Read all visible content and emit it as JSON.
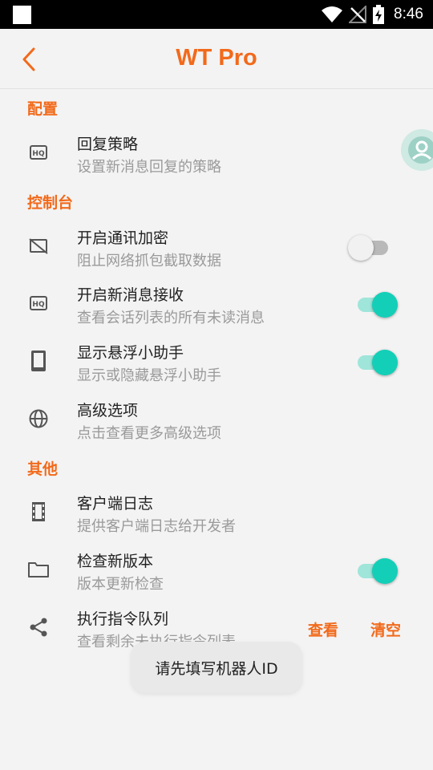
{
  "status_bar": {
    "time": "8:46"
  },
  "app_bar": {
    "title": "WT Pro",
    "back_icon": "chevron-left-icon"
  },
  "sections": {
    "config": "配置",
    "console": "控制台",
    "other": "其他"
  },
  "rows": {
    "reply_policy": {
      "title": "回复策略",
      "subtitle": "设置新消息回复的策略",
      "icon": "hq-icon"
    },
    "encrypt": {
      "title": "开启通讯加密",
      "subtitle": "阻止网络抓包截取数据",
      "icon": "no-screen-icon",
      "enabled": false
    },
    "receive": {
      "title": "开启新消息接收",
      "subtitle": "查看会话列表的所有未读消息",
      "icon": "hq-icon",
      "enabled": true
    },
    "floating": {
      "title": "显示悬浮小助手",
      "subtitle": "显示或隐藏悬浮小助手",
      "icon": "tablet-icon",
      "enabled": true
    },
    "advanced": {
      "title": "高级选项",
      "subtitle": "点击查看更多高级选项",
      "icon": "globe-icon"
    },
    "client_log": {
      "title": "客户端日志",
      "subtitle": "提供客户端日志给开发者",
      "icon": "film-icon"
    },
    "check_update": {
      "title": "检查新版本",
      "subtitle": "版本更新检查",
      "icon": "folder-icon",
      "enabled": true
    },
    "queue": {
      "title": "执行指令队列",
      "subtitle": "查看剩余未执行指令列表",
      "icon": "share-icon",
      "view_label": "查看",
      "clear_label": "清空"
    }
  },
  "toast": {
    "text": "请先填写机器人ID"
  },
  "colors": {
    "accent": "#f26a1b",
    "toggle_on": "#13cfb8",
    "toggle_track_on": "#9fe5da",
    "background": "#f3f3f3"
  }
}
